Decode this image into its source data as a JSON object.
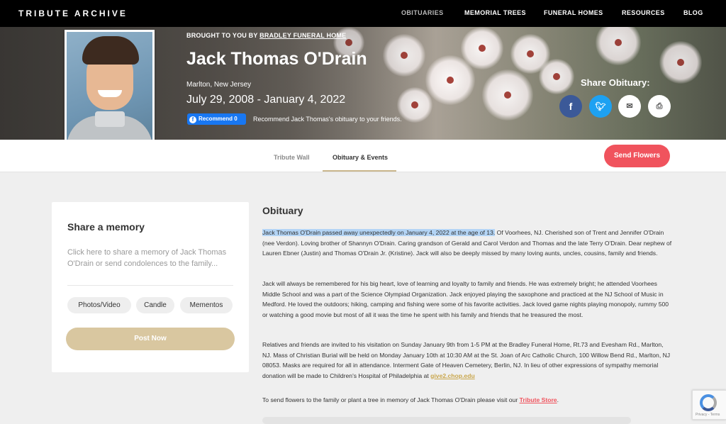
{
  "topnav": {
    "brand": "TRIBUTE ARCHIVE",
    "items": [
      "OBITUARIES",
      "MEMORIAL TREES",
      "FUNERAL HOMES",
      "RESOURCES",
      "BLOG"
    ]
  },
  "hero": {
    "brought_prefix": "BROUGHT TO YOU BY ",
    "brought_link": "BRADLEY FUNERAL HOME",
    "name": "Jack Thomas O'Drain",
    "location": "Marlton, New Jersey",
    "dates": "July 29, 2008 - January 4, 2022",
    "recommend_button": "Recommend 0",
    "recommend_text": "Recommend Jack Thomas's obituary to your friends.",
    "share_label": "Share Obituary:"
  },
  "tabs": {
    "tribute_wall": "Tribute Wall",
    "obituary_events": "Obituary & Events",
    "send_flowers": "Send Flowers"
  },
  "memory": {
    "title": "Share a memory",
    "prompt": "Click here to share a memory of Jack Thomas O'Drain or send condolences to the family...",
    "buttons": [
      "Photos/Video",
      "Candle",
      "Mementos"
    ],
    "post": "Post Now"
  },
  "obituary": {
    "heading": "Obituary",
    "p1_highlight": "Jack Thomas O'Drain passed away unexpectedly on January 4, 2022 at the age of 13.",
    "p1_rest": " Of Voorhees, NJ. Cherished son of Trent and Jennifer O'Drain (nee Verdon). Loving brother of Shannyn O'Drain. Caring grandson of Gerald and Carol Verdon and Thomas and the late Terry O'Drain. Dear nephew of Lauren Ebner (Justin) and Thomas O'Drain Jr. (Kristine). Jack will also be deeply missed by many loving aunts, uncles, cousins, family and friends.",
    "p2": "Jack will always be remembered for his big heart, love of learning and loyalty to family and friends. He was extremely bright; he attended Voorhees Middle School and was a part of the Science Olympiad Organization. Jack enjoyed playing the saxophone and practiced at the NJ School of Music in Medford. He loved the outdoors; hiking, camping and fishing were some of his favorite activities. Jack loved game nights playing monopoly, rummy 500 or watching a good movie but most of all it was the time he spent with his family and friends that he treasured the most.",
    "p3": "Relatives and friends are invited to his visitation on Sunday January 9th from 1-5 PM at the Bradley Funeral Home, Rt.73 and Evesham Rd., Marlton, NJ. Mass of Christian Burial will be held on Monday January 10th at 10:30 AM at the St. Joan of Arc Catholic Church, 100 Willow Bend Rd., Marlton, NJ 08053. Masks are required for all in attendance. Interment Gate of Heaven Cemetery, Berlin, NJ. In lieu of other expressions of sympathy memorial donation will be made to Children's Hospital of Philadelphia at ",
    "p3_link": "give2.chop.edu",
    "p4": "To send flowers to the family or plant a tree in memory of Jack Thomas O'Drain please visit our ",
    "p4_link": "Tribute Store",
    "p4_end": "."
  },
  "recaptcha": {
    "text": "Privacy - Terms"
  },
  "colors": {
    "send_flowers": "#f0535d",
    "post_now": "#d9c7a0",
    "tab_underline": "#c9b68c",
    "facebook": "#3b5998",
    "twitter": "#1da1f2",
    "highlight": "#b3d4f5"
  },
  "icons": {
    "share": [
      "facebook-icon",
      "twitter-icon",
      "email-icon",
      "print-icon"
    ]
  }
}
